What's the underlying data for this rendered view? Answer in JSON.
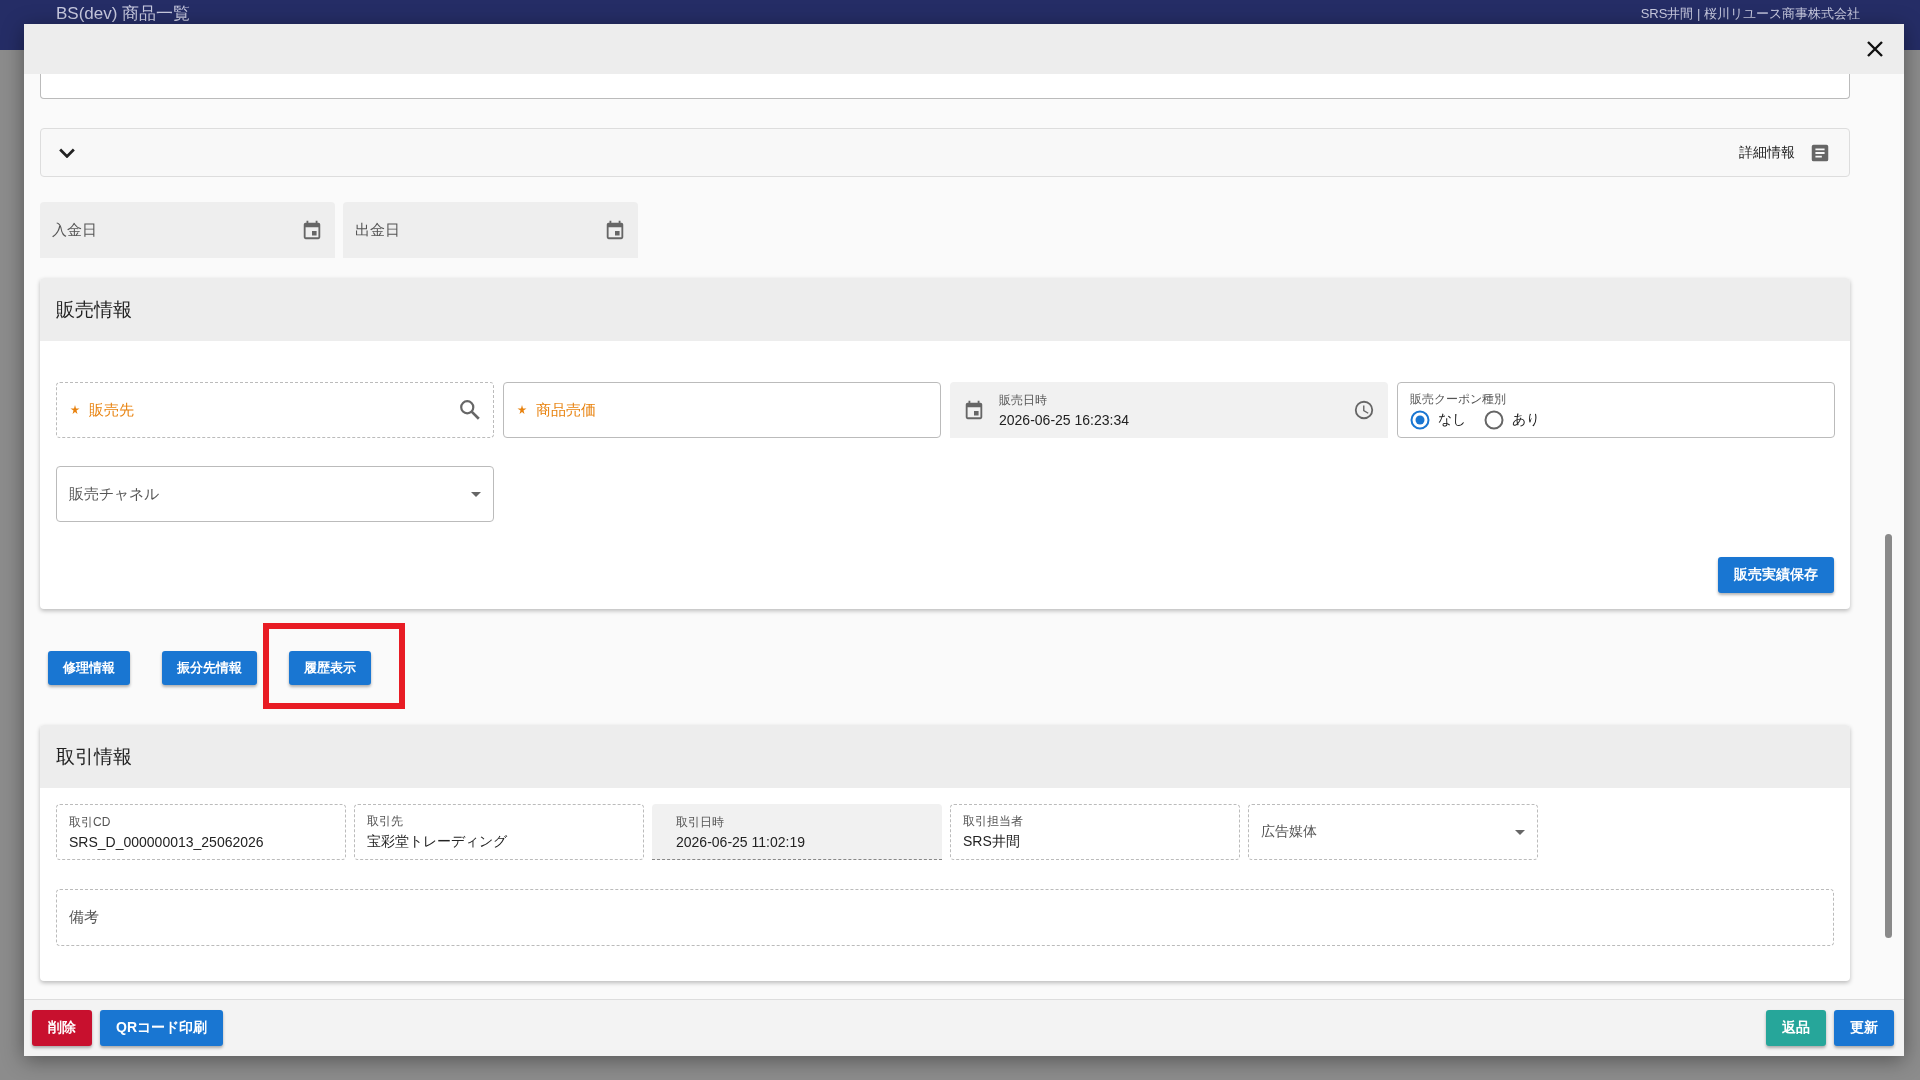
{
  "app_bar": {
    "title": "BS(dev) 商品一覧",
    "user": "SRS井間 | 桜川リユース商事株式会社"
  },
  "dialog": {
    "accordion": {
      "label": "詳細情報",
      "expanded": false
    },
    "date_fields": [
      {
        "placeholder": "入金日"
      },
      {
        "placeholder": "出金日"
      }
    ],
    "sales_section": {
      "title": "販売情報",
      "fields": [
        {
          "kind": "search",
          "label": "販売先",
          "required": true
        },
        {
          "kind": "text",
          "label": "商品売価",
          "required": true
        },
        {
          "kind": "datetime",
          "label": "販売日時",
          "value": "2026-06-25 16:23:34"
        },
        {
          "kind": "radio",
          "label": "販売クーポン種別",
          "options": [
            {
              "label": "なし",
              "selected": true
            },
            {
              "label": "あり",
              "selected": false
            }
          ]
        },
        {
          "kind": "select",
          "placeholder": "販売チャネル"
        }
      ],
      "save_button": "販売実績保存"
    },
    "action_buttons": [
      {
        "label": "修理情報",
        "highlighted": false
      },
      {
        "label": "振分先情報",
        "highlighted": false
      },
      {
        "label": "履歴表示",
        "highlighted": true
      }
    ],
    "transaction_section": {
      "title": "取引情報",
      "fields": [
        {
          "kind": "text",
          "label": "取引CD",
          "value": "SRS_D_000000013_25062026"
        },
        {
          "kind": "text",
          "label": "取引先",
          "value": "宝彩堂トレーディング"
        },
        {
          "kind": "readonly",
          "label": "取引日時",
          "value": "2026-06-25 11:02:19"
        },
        {
          "kind": "text",
          "label": "取引担当者",
          "value": "SRS井間"
        },
        {
          "kind": "select",
          "placeholder": "広告媒体"
        }
      ],
      "remarks": {
        "placeholder": "備考"
      }
    },
    "footer": {
      "left": [
        {
          "label": "削除",
          "kind": "danger"
        },
        {
          "label": "QRコード印刷",
          "kind": "primary"
        }
      ],
      "right": [
        {
          "label": "返品",
          "kind": "success"
        },
        {
          "label": "更新",
          "kind": "primary"
        }
      ]
    }
  }
}
